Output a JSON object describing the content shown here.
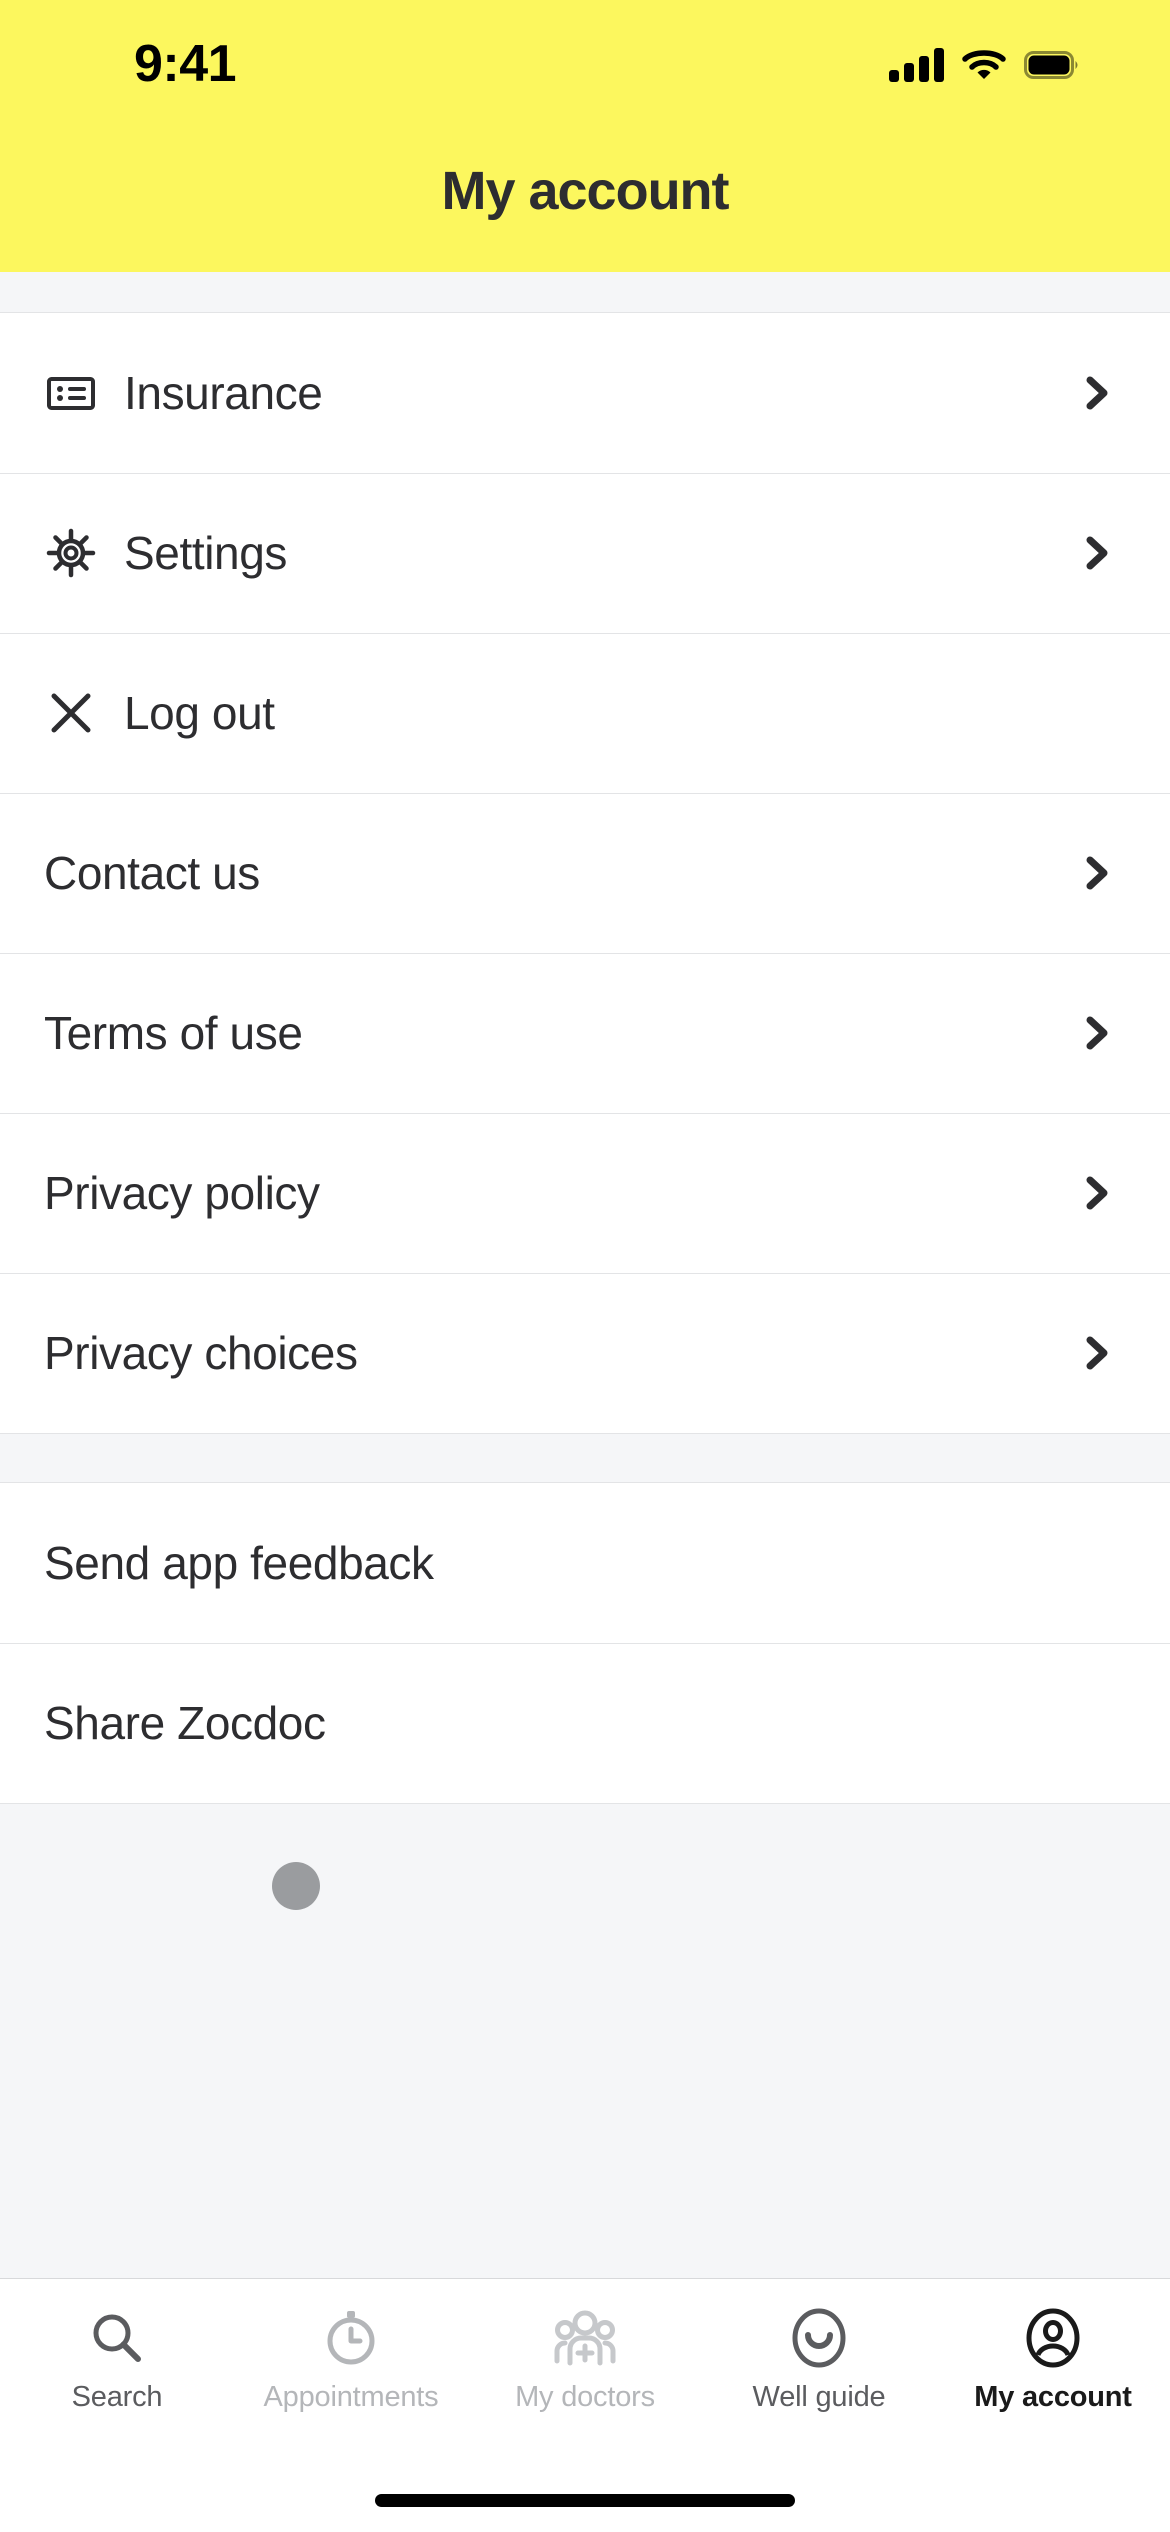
{
  "status_bar": {
    "time": "9:41",
    "signal_icon": "cellular-signal-icon",
    "wifi_icon": "wifi-icon",
    "battery_icon": "battery-full-icon"
  },
  "header": {
    "title": "My account",
    "background_color": "#FCF75E",
    "title_color": "#2D2D30"
  },
  "menu_groups": [
    {
      "items": [
        {
          "label": "Insurance",
          "icon": "insurance-card-icon",
          "chevron": true
        },
        {
          "label": "Settings",
          "icon": "gear-icon",
          "chevron": true
        },
        {
          "label": "Log out",
          "icon": "close-x-icon",
          "chevron": false
        },
        {
          "label": "Contact us",
          "icon": null,
          "chevron": true
        },
        {
          "label": "Terms of use",
          "icon": null,
          "chevron": true
        },
        {
          "label": "Privacy policy",
          "icon": null,
          "chevron": true
        },
        {
          "label": "Privacy choices",
          "icon": null,
          "chevron": true
        }
      ]
    },
    {
      "items": [
        {
          "label": "Send app feedback",
          "icon": null,
          "chevron": false
        },
        {
          "label": "Share Zocdoc",
          "icon": null,
          "chevron": false
        }
      ]
    }
  ],
  "placeholder": {
    "dot_icon": "loading-dot",
    "dot_color": "#9A9C9F"
  },
  "tab_bar": {
    "items": [
      {
        "label": "Search",
        "icon": "search-icon",
        "state": "strong"
      },
      {
        "label": "Appointments",
        "icon": "stopwatch-icon",
        "state": "dim"
      },
      {
        "label": "My doctors",
        "icon": "doctors-group-icon",
        "state": "dim"
      },
      {
        "label": "Well guide",
        "icon": "smiley-circle-icon",
        "state": "strong"
      },
      {
        "label": "My account",
        "icon": "person-circle-icon",
        "state": "active"
      }
    ]
  },
  "home_indicator": {
    "name": "home-indicator-bar",
    "color": "#000000"
  }
}
